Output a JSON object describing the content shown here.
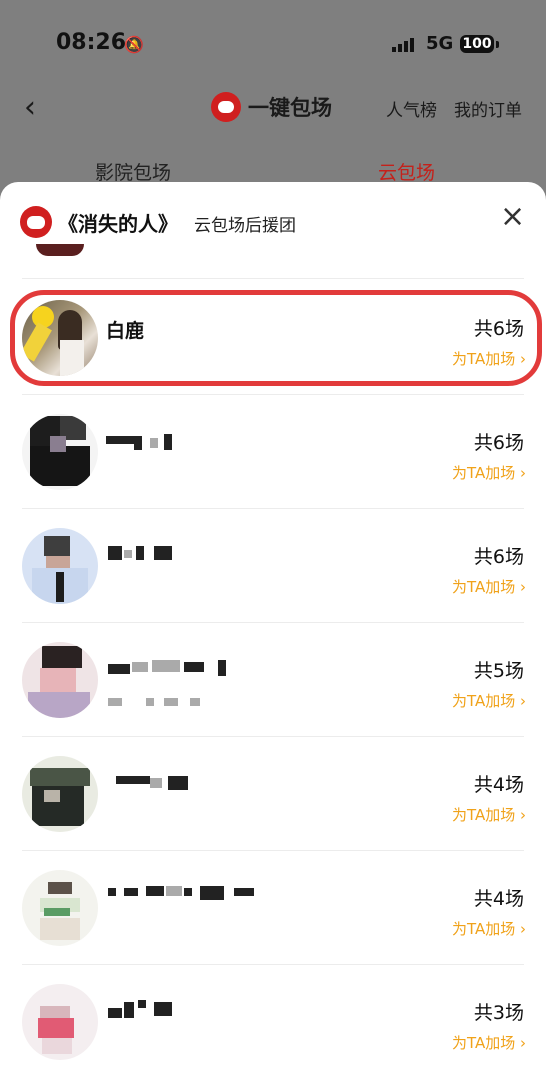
{
  "status": {
    "time": "08:26",
    "network": "5G",
    "battery": "100"
  },
  "nav": {
    "back": "‹",
    "title": "一键包场",
    "links": [
      "人气榜",
      "我的订单"
    ]
  },
  "tabs": [
    {
      "label": "影院包场",
      "active": false
    },
    {
      "label": "云包场",
      "active": true
    }
  ],
  "sheet": {
    "film_title": "《消失的人》",
    "subtitle": "云包场后援团",
    "close": "×"
  },
  "rows": [
    {
      "name": "白鹿",
      "count": "共6场",
      "action": "为TA加场 ›",
      "highlighted": true
    },
    {
      "name": "",
      "count": "共6场",
      "action": "为TA加场 ›"
    },
    {
      "name": "",
      "count": "共6场",
      "action": "为TA加场 ›"
    },
    {
      "name": "",
      "count": "共5场",
      "action": "为TA加场 ›"
    },
    {
      "name": "",
      "count": "共4场",
      "action": "为TA加场 ›"
    },
    {
      "name": "",
      "count": "共4场",
      "action": "为TA加场 ›"
    },
    {
      "name": "",
      "count": "共3场",
      "action": "为TA加场 ›"
    }
  ],
  "colors": {
    "brand": "#d01f1f",
    "active_tab": "#c4211b",
    "boost": "#f0a21a",
    "highlight": "#e23b3b"
  },
  "icons": [
    "back-arrow-icon",
    "bell-muted-icon",
    "signal-icon",
    "battery-icon",
    "cat-logo-icon",
    "close-icon"
  ]
}
